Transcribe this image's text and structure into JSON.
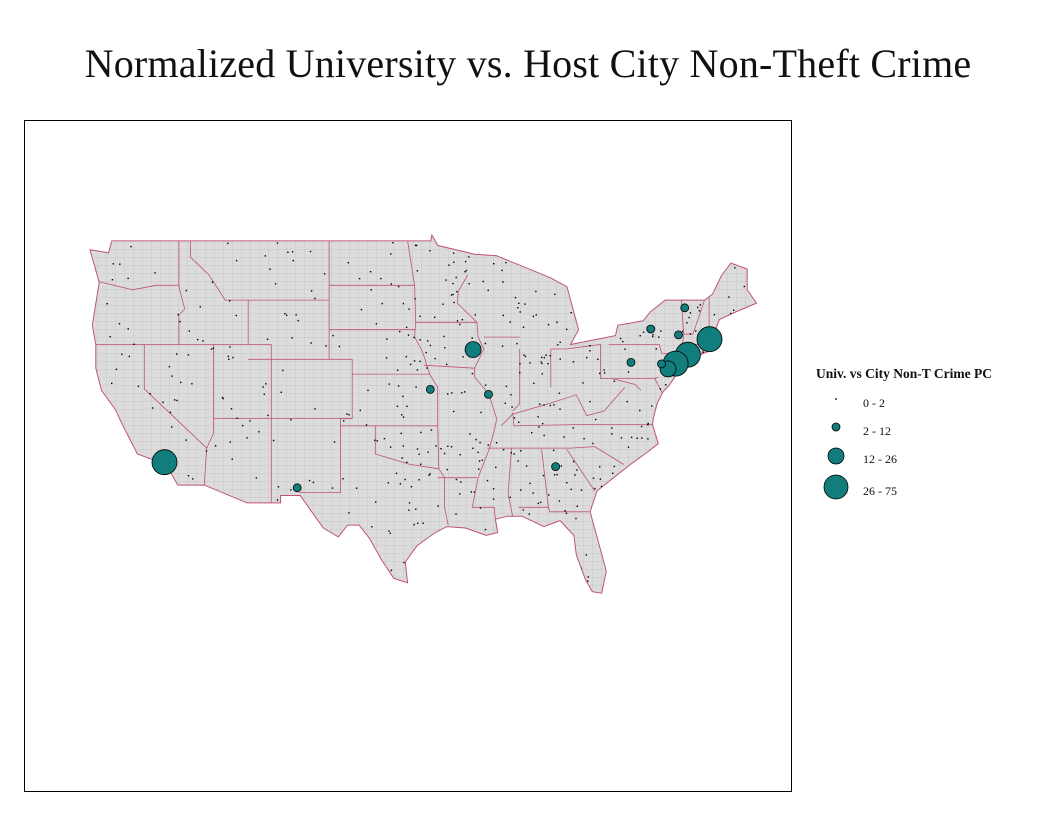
{
  "title": "Normalized University vs. Host City Non-Theft Crime",
  "legend": {
    "title": "Univ. vs City Non-T Crime PC",
    "classes": [
      {
        "label": "0 - 2",
        "size_class": 0
      },
      {
        "label": "2 - 12",
        "size_class": 1
      },
      {
        "label": "12 - 26",
        "size_class": 2
      },
      {
        "label": "26 - 75",
        "size_class": 3
      }
    ]
  },
  "colors": {
    "land": "#dcdcdc",
    "county_lines": "#9a9a9a",
    "state_lines": "#c0507e",
    "symbol_fill": "#127d7d",
    "symbol_stroke": "#000000",
    "small_dots": "#000000"
  },
  "map": {
    "projection": "lon/lat equirectangular",
    "symbols": [
      {
        "city": "Los Angeles, CA",
        "lon": -118.25,
        "lat": 34.05,
        "class": 3
      },
      {
        "city": "Boston, MA",
        "lon": -71.06,
        "lat": 42.36,
        "class": 3
      },
      {
        "city": "New Haven, CT",
        "lon": -72.93,
        "lat": 41.31,
        "class": 3
      },
      {
        "city": "New York, NY",
        "lon": -74.0,
        "lat": 40.71,
        "class": 3
      },
      {
        "city": "Princeton, NJ",
        "lon": -74.66,
        "lat": 40.35,
        "class": 2
      },
      {
        "city": "Iowa City, IA",
        "lon": -91.53,
        "lat": 41.66,
        "class": 2
      },
      {
        "city": "Burlington, VT",
        "lon": -73.21,
        "lat": 44.48,
        "class": 1
      },
      {
        "city": "Syracuse, NY",
        "lon": -76.15,
        "lat": 43.05,
        "class": 1
      },
      {
        "city": "Albany, NY",
        "lon": -73.75,
        "lat": 42.65,
        "class": 1
      },
      {
        "city": "State College, PA",
        "lon": -77.86,
        "lat": 40.79,
        "class": 1
      },
      {
        "city": "Easton, PA",
        "lon": -75.22,
        "lat": 40.69,
        "class": 1
      },
      {
        "city": "Lawrence, KS",
        "lon": -95.24,
        "lat": 38.97,
        "class": 1
      },
      {
        "city": "St. Louis, MO",
        "lon": -90.2,
        "lat": 38.63,
        "class": 1
      },
      {
        "city": "Las Cruces, NM",
        "lon": -106.76,
        "lat": 32.32,
        "class": 1
      },
      {
        "city": "Atlanta, GA",
        "lon": -84.39,
        "lat": 33.75,
        "class": 1
      }
    ]
  }
}
